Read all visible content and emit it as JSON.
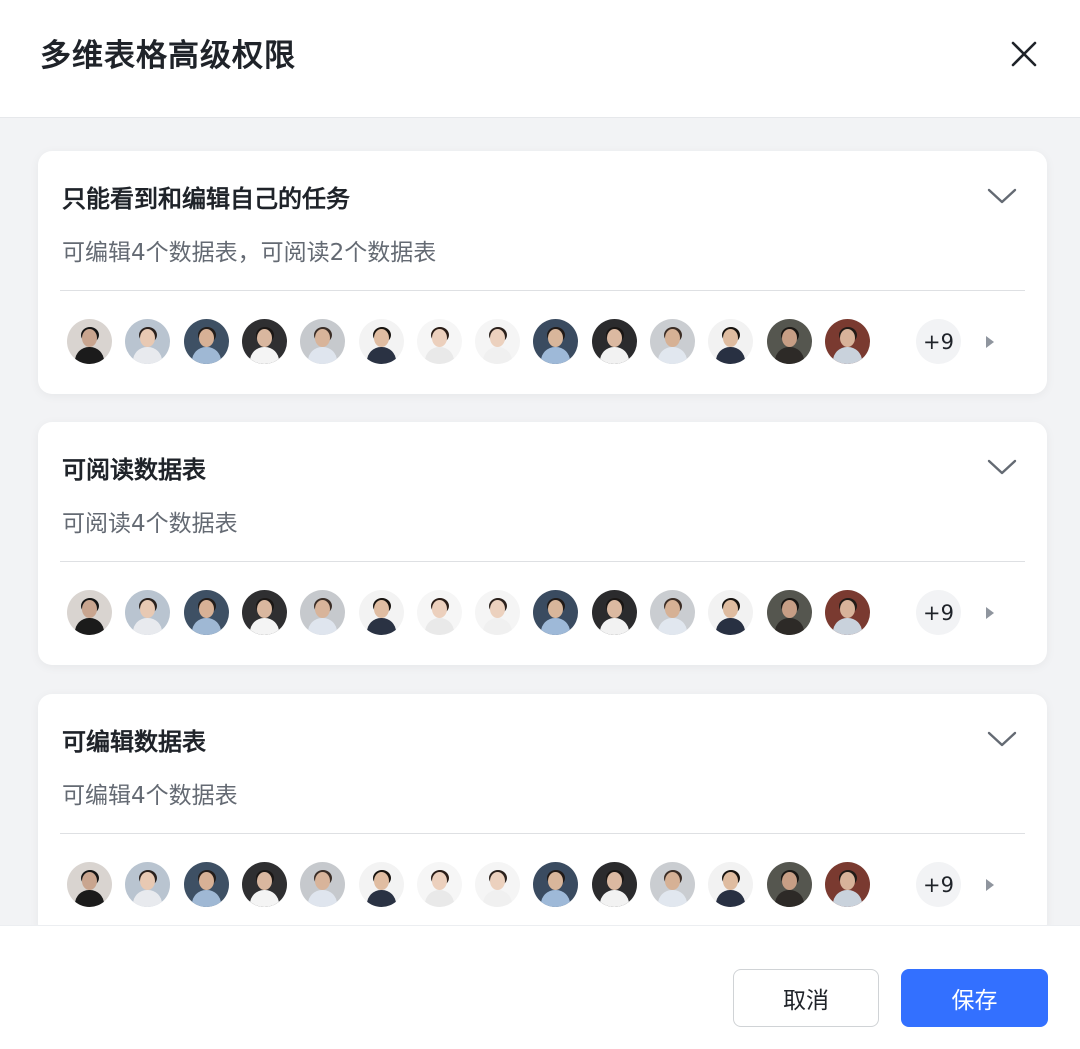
{
  "dialog": {
    "title": "多维表格高级权限"
  },
  "cards": [
    {
      "title": "只能看到和编辑自己的任务",
      "desc": "可编辑4个数据表，可阅读2个数据表",
      "more": "+9"
    },
    {
      "title": "可阅读数据表",
      "desc": "可阅读4个数据表",
      "more": "+9"
    },
    {
      "title": "可编辑数据表",
      "desc": "可编辑4个数据表",
      "more": "+9"
    }
  ],
  "avatars": [
    {
      "bg": "#d9d4d0",
      "skin": "#c9a58f",
      "shirt": "#1b1b1b",
      "hair": "#151515"
    },
    {
      "bg": "#b9c4d0",
      "skin": "#e8c9b3",
      "shirt": "#e8eaee",
      "hair": "#2a211d"
    },
    {
      "bg": "#3e5064",
      "skin": "#d7b196",
      "shirt": "#9fb8d4",
      "hair": "#231d1a"
    },
    {
      "bg": "#2f2f31",
      "skin": "#d9b79f",
      "shirt": "#f4f4f4",
      "hair": "#1b1715"
    },
    {
      "bg": "#c6c9cd",
      "skin": "#d8b49a",
      "shirt": "#dfe5ee",
      "hair": "#3a2d26"
    },
    {
      "bg": "#f3f3f3",
      "skin": "#e0bda2",
      "shirt": "#2a3243",
      "hair": "#17130f"
    },
    {
      "bg": "#f6f6f6",
      "skin": "#ecd0bd",
      "shirt": "#e9e9e9",
      "hair": "#2a1d17"
    },
    {
      "bg": "#f5f5f5",
      "skin": "#ecd1be",
      "shirt": "#f0f0f0",
      "hair": "#2b211c"
    },
    {
      "bg": "#3a4b60",
      "skin": "#d8b69b",
      "shirt": "#9eb9d8",
      "hair": "#211a17"
    },
    {
      "bg": "#2b2b2d",
      "skin": "#dbb9a1",
      "shirt": "#f2f2f2",
      "hair": "#1a1614"
    },
    {
      "bg": "#cacdd1",
      "skin": "#d6b195",
      "shirt": "#e1e7ef",
      "hair": "#3b2d25"
    },
    {
      "bg": "#f2f2f2",
      "skin": "#dfbca0",
      "shirt": "#283042",
      "hair": "#17130f"
    },
    {
      "bg": "#55564f",
      "skin": "#c79e85",
      "shirt": "#2d2a27",
      "hair": "#1a1714"
    },
    {
      "bg": "#7a3a30",
      "skin": "#d8b39a",
      "shirt": "#c9d2dc",
      "hair": "#221b17"
    }
  ],
  "footer": {
    "cancel_label": "取消",
    "save_label": "保存"
  },
  "icons": {
    "close": "close-icon",
    "chevron": "chevron-down-icon",
    "expand": "triangle-right-icon"
  },
  "colors": {
    "primary": "#3370ff"
  }
}
